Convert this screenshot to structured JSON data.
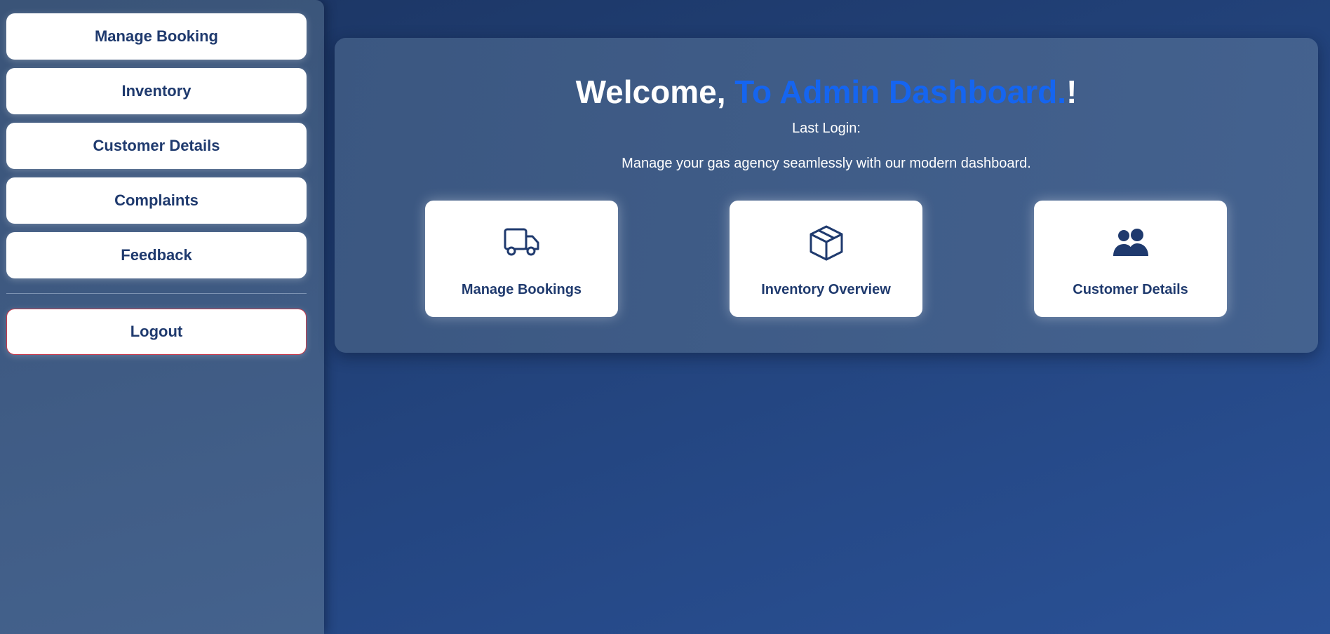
{
  "sidebar": {
    "items": [
      {
        "label": "Manage Booking"
      },
      {
        "label": "Inventory"
      },
      {
        "label": "Customer Details"
      },
      {
        "label": "Complaints"
      },
      {
        "label": "Feedback"
      }
    ],
    "logout_label": "Logout"
  },
  "main": {
    "welcome_prefix": "Welcome, ",
    "welcome_accent": "To Admin Dashboard.",
    "welcome_suffix": "!",
    "last_login_label": "Last Login:",
    "tagline": "Manage your gas agency seamlessly with our modern dashboard.",
    "cards": [
      {
        "label": "Manage Bookings",
        "icon": "truck-icon"
      },
      {
        "label": "Inventory Overview",
        "icon": "box-icon"
      },
      {
        "label": "Customer Details",
        "icon": "users-icon"
      }
    ]
  },
  "colors": {
    "brand_navy": "#1f3a6e",
    "accent_blue": "#1565f0",
    "logout_border": "#c8394a"
  }
}
